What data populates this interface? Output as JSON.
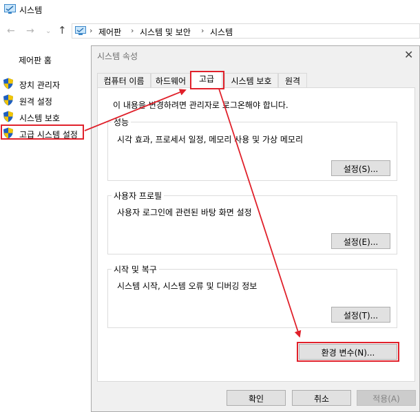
{
  "window": {
    "title": "시스템",
    "breadcrumb": [
      "제어판",
      "시스템 및 보안",
      "시스템"
    ]
  },
  "sidebar": {
    "home": "제어판 홈",
    "items": [
      {
        "label": "장치 관리자"
      },
      {
        "label": "원격 설정"
      },
      {
        "label": "시스템 보호"
      },
      {
        "label": "고급 시스템 설정"
      }
    ]
  },
  "dialog": {
    "title": "시스템 속성",
    "tabs": [
      "컴퓨터 이름",
      "하드웨어",
      "고급",
      "시스템 보호",
      "원격"
    ],
    "active_tab": "고급",
    "admin_note": "이 내용을 변경하려면 관리자로 로그온해야 합니다.",
    "groups": {
      "performance": {
        "legend": "성능",
        "desc": "시각 효과, 프로세서 일정, 메모리 사용 및 가상 메모리",
        "button": "설정(S)..."
      },
      "profiles": {
        "legend": "사용자 프로필",
        "desc": "사용자 로그인에 관련된 바탕 화면 설정",
        "button": "설정(E)..."
      },
      "startup": {
        "legend": "시작 및 복구",
        "desc": "시스템 시작, 시스템 오류 및 디버깅 정보",
        "button": "설정(T)..."
      }
    },
    "env_button": "환경 변수(N)...",
    "ok": "확인",
    "cancel": "취소",
    "apply": "적용(A)"
  },
  "colors": {
    "highlight": "#e0202a",
    "shield_blue": "#1f5fbf",
    "shield_yellow": "#f2c500"
  }
}
